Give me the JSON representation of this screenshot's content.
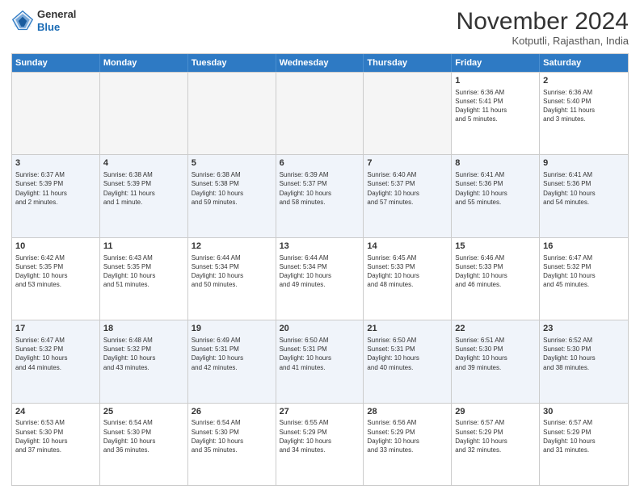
{
  "logo": {
    "line1": "General",
    "line2": "Blue"
  },
  "title": {
    "month_year": "November 2024",
    "location": "Kotputli, Rajasthan, India"
  },
  "calendar": {
    "headers": [
      "Sunday",
      "Monday",
      "Tuesday",
      "Wednesday",
      "Thursday",
      "Friday",
      "Saturday"
    ],
    "rows": [
      [
        {
          "day": "",
          "info": "",
          "empty": true
        },
        {
          "day": "",
          "info": "",
          "empty": true
        },
        {
          "day": "",
          "info": "",
          "empty": true
        },
        {
          "day": "",
          "info": "",
          "empty": true
        },
        {
          "day": "",
          "info": "",
          "empty": true
        },
        {
          "day": "1",
          "info": "Sunrise: 6:36 AM\nSunset: 5:41 PM\nDaylight: 11 hours\nand 5 minutes.",
          "empty": false
        },
        {
          "day": "2",
          "info": "Sunrise: 6:36 AM\nSunset: 5:40 PM\nDaylight: 11 hours\nand 3 minutes.",
          "empty": false
        }
      ],
      [
        {
          "day": "3",
          "info": "Sunrise: 6:37 AM\nSunset: 5:39 PM\nDaylight: 11 hours\nand 2 minutes.",
          "empty": false
        },
        {
          "day": "4",
          "info": "Sunrise: 6:38 AM\nSunset: 5:39 PM\nDaylight: 11 hours\nand 1 minute.",
          "empty": false
        },
        {
          "day": "5",
          "info": "Sunrise: 6:38 AM\nSunset: 5:38 PM\nDaylight: 10 hours\nand 59 minutes.",
          "empty": false
        },
        {
          "day": "6",
          "info": "Sunrise: 6:39 AM\nSunset: 5:37 PM\nDaylight: 10 hours\nand 58 minutes.",
          "empty": false
        },
        {
          "day": "7",
          "info": "Sunrise: 6:40 AM\nSunset: 5:37 PM\nDaylight: 10 hours\nand 57 minutes.",
          "empty": false
        },
        {
          "day": "8",
          "info": "Sunrise: 6:41 AM\nSunset: 5:36 PM\nDaylight: 10 hours\nand 55 minutes.",
          "empty": false
        },
        {
          "day": "9",
          "info": "Sunrise: 6:41 AM\nSunset: 5:36 PM\nDaylight: 10 hours\nand 54 minutes.",
          "empty": false
        }
      ],
      [
        {
          "day": "10",
          "info": "Sunrise: 6:42 AM\nSunset: 5:35 PM\nDaylight: 10 hours\nand 53 minutes.",
          "empty": false
        },
        {
          "day": "11",
          "info": "Sunrise: 6:43 AM\nSunset: 5:35 PM\nDaylight: 10 hours\nand 51 minutes.",
          "empty": false
        },
        {
          "day": "12",
          "info": "Sunrise: 6:44 AM\nSunset: 5:34 PM\nDaylight: 10 hours\nand 50 minutes.",
          "empty": false
        },
        {
          "day": "13",
          "info": "Sunrise: 6:44 AM\nSunset: 5:34 PM\nDaylight: 10 hours\nand 49 minutes.",
          "empty": false
        },
        {
          "day": "14",
          "info": "Sunrise: 6:45 AM\nSunset: 5:33 PM\nDaylight: 10 hours\nand 48 minutes.",
          "empty": false
        },
        {
          "day": "15",
          "info": "Sunrise: 6:46 AM\nSunset: 5:33 PM\nDaylight: 10 hours\nand 46 minutes.",
          "empty": false
        },
        {
          "day": "16",
          "info": "Sunrise: 6:47 AM\nSunset: 5:32 PM\nDaylight: 10 hours\nand 45 minutes.",
          "empty": false
        }
      ],
      [
        {
          "day": "17",
          "info": "Sunrise: 6:47 AM\nSunset: 5:32 PM\nDaylight: 10 hours\nand 44 minutes.",
          "empty": false
        },
        {
          "day": "18",
          "info": "Sunrise: 6:48 AM\nSunset: 5:32 PM\nDaylight: 10 hours\nand 43 minutes.",
          "empty": false
        },
        {
          "day": "19",
          "info": "Sunrise: 6:49 AM\nSunset: 5:31 PM\nDaylight: 10 hours\nand 42 minutes.",
          "empty": false
        },
        {
          "day": "20",
          "info": "Sunrise: 6:50 AM\nSunset: 5:31 PM\nDaylight: 10 hours\nand 41 minutes.",
          "empty": false
        },
        {
          "day": "21",
          "info": "Sunrise: 6:50 AM\nSunset: 5:31 PM\nDaylight: 10 hours\nand 40 minutes.",
          "empty": false
        },
        {
          "day": "22",
          "info": "Sunrise: 6:51 AM\nSunset: 5:30 PM\nDaylight: 10 hours\nand 39 minutes.",
          "empty": false
        },
        {
          "day": "23",
          "info": "Sunrise: 6:52 AM\nSunset: 5:30 PM\nDaylight: 10 hours\nand 38 minutes.",
          "empty": false
        }
      ],
      [
        {
          "day": "24",
          "info": "Sunrise: 6:53 AM\nSunset: 5:30 PM\nDaylight: 10 hours\nand 37 minutes.",
          "empty": false
        },
        {
          "day": "25",
          "info": "Sunrise: 6:54 AM\nSunset: 5:30 PM\nDaylight: 10 hours\nand 36 minutes.",
          "empty": false
        },
        {
          "day": "26",
          "info": "Sunrise: 6:54 AM\nSunset: 5:30 PM\nDaylight: 10 hours\nand 35 minutes.",
          "empty": false
        },
        {
          "day": "27",
          "info": "Sunrise: 6:55 AM\nSunset: 5:29 PM\nDaylight: 10 hours\nand 34 minutes.",
          "empty": false
        },
        {
          "day": "28",
          "info": "Sunrise: 6:56 AM\nSunset: 5:29 PM\nDaylight: 10 hours\nand 33 minutes.",
          "empty": false
        },
        {
          "day": "29",
          "info": "Sunrise: 6:57 AM\nSunset: 5:29 PM\nDaylight: 10 hours\nand 32 minutes.",
          "empty": false
        },
        {
          "day": "30",
          "info": "Sunrise: 6:57 AM\nSunset: 5:29 PM\nDaylight: 10 hours\nand 31 minutes.",
          "empty": false
        }
      ]
    ]
  }
}
